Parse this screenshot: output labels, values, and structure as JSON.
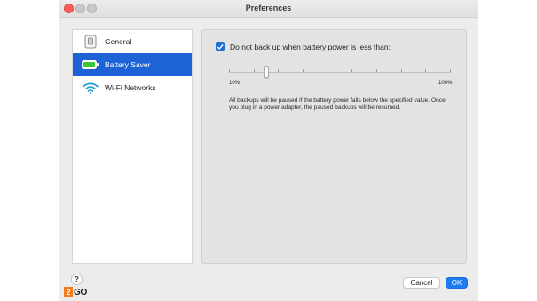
{
  "window": {
    "title": "Preferences"
  },
  "sidebar": {
    "items": [
      {
        "label": "General",
        "icon": "general-icon",
        "selected": false
      },
      {
        "label": "Battery Saver",
        "icon": "battery-icon",
        "selected": true
      },
      {
        "label": "Wi-Fi Networks",
        "icon": "wifi-icon",
        "selected": false
      }
    ]
  },
  "battery": {
    "checkbox_label": "Do not back up when battery power is less than:",
    "checkbox_checked": true,
    "slider_min_label": "10%",
    "slider_max_label": "100%",
    "slider_value_percent": 25,
    "description": "All backups will be paused if the battery power falls below the specified value. Once you plug in a power adapter, the paused backups will be resumed."
  },
  "footer": {
    "help_label": "?",
    "cancel_label": "Cancel",
    "ok_label": "OK"
  },
  "watermark": {
    "digit": "2",
    "text": "GO"
  },
  "colors": {
    "accent": "#1e63d6",
    "ok_button": "#1e7cf2",
    "close_button": "#ff5f57",
    "watermark_orange": "#f07d19"
  }
}
